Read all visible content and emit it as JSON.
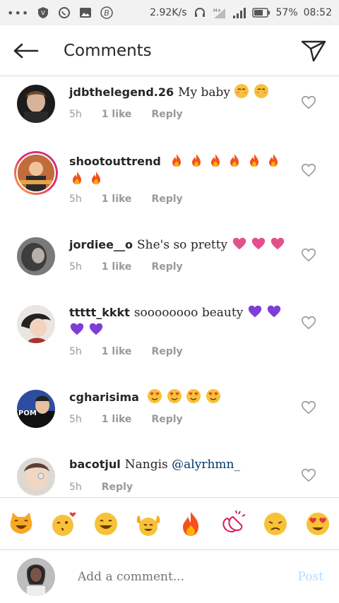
{
  "status": {
    "speed": "2.92K/s",
    "battery": "57%",
    "time": "08:52"
  },
  "header": {
    "title": "Comments"
  },
  "comments": [
    {
      "user": "jdbthelegend.26",
      "text": "My baby",
      "time": "5h",
      "likes": "1 like",
      "reply": "Reply"
    },
    {
      "user": "shootouttrend",
      "text": "",
      "time": "5h",
      "likes": "1 like",
      "reply": "Reply"
    },
    {
      "user": "jordiee__o",
      "text": "She's so pretty",
      "time": "5h",
      "likes": "1 like",
      "reply": "Reply"
    },
    {
      "user": "ttttt_kkkt",
      "text": "soooooooo beauty",
      "time": "5h",
      "likes": "1 like",
      "reply": "Reply"
    },
    {
      "user": "cgharisima",
      "text": "",
      "time": "5h",
      "likes": "1 like",
      "reply": "Reply"
    },
    {
      "user": "bacotjul",
      "text": "Nangis",
      "mention": "@alyrhmn_",
      "time": "5h",
      "reply": "Reply"
    }
  ],
  "composer": {
    "placeholder": "Add a comment...",
    "post_label": "Post"
  },
  "icons": {
    "emoji_bar": [
      "grinning-cat-icon",
      "kissing-face-icon",
      "smiling-face-icon",
      "raised-hands-icon",
      "fire-icon",
      "clapping-hands-icon",
      "sad-face-icon",
      "heart-eyes-icon"
    ]
  },
  "colors": {
    "mention": "#003569",
    "post_disabled": "#b3dbff",
    "meta_gray": "#999999"
  }
}
